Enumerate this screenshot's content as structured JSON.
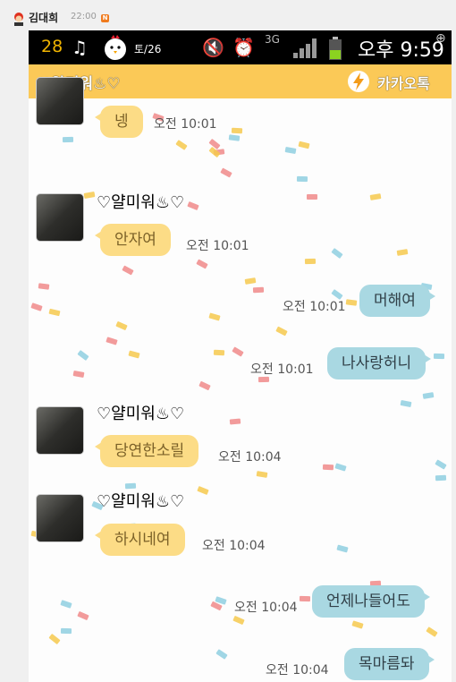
{
  "post": {
    "author": "김대희",
    "time": "22:00",
    "new_badge": "N"
  },
  "status_bar": {
    "notification_count": "28",
    "date": "토/26",
    "network": "3G",
    "clock": "오후 9:59"
  },
  "chat_title": "♡얄미워♨♡",
  "brand": "카카오톡",
  "messages": [
    {
      "side": "in",
      "text": "넹",
      "time": "오전 10:01"
    },
    {
      "side": "in",
      "sender": "♡얄미워♨♡",
      "text": "안자여",
      "time": "오전 10:01"
    },
    {
      "side": "out",
      "text": "머해여",
      "time": "오전 10:01"
    },
    {
      "side": "out",
      "text": "나사랑허니",
      "time": "오전 10:01"
    },
    {
      "side": "in",
      "sender": "♡얄미워♨♡",
      "text": "당연한소릴",
      "time": "오전 10:04"
    },
    {
      "side": "in",
      "sender": "♡얄미워♨♡",
      "text": "하시네여",
      "time": "오전 10:04"
    },
    {
      "side": "out",
      "text": "언제나들어도",
      "time": "오전 10:04"
    },
    {
      "side": "out",
      "text": "목마름돠",
      "time": "오전 10:04"
    }
  ],
  "colors": {
    "title_bar": "#fbc957",
    "incoming_bubble": "#fcdc86",
    "outgoing_bubble": "#a9d8e2",
    "status_bar": "#000000"
  },
  "icons": [
    "mascot-icon",
    "music-icon",
    "chick-icon",
    "mute-icon",
    "alarm-icon",
    "signal-icon",
    "battery-icon",
    "zoom-icon",
    "kakao-lightning-icon"
  ]
}
